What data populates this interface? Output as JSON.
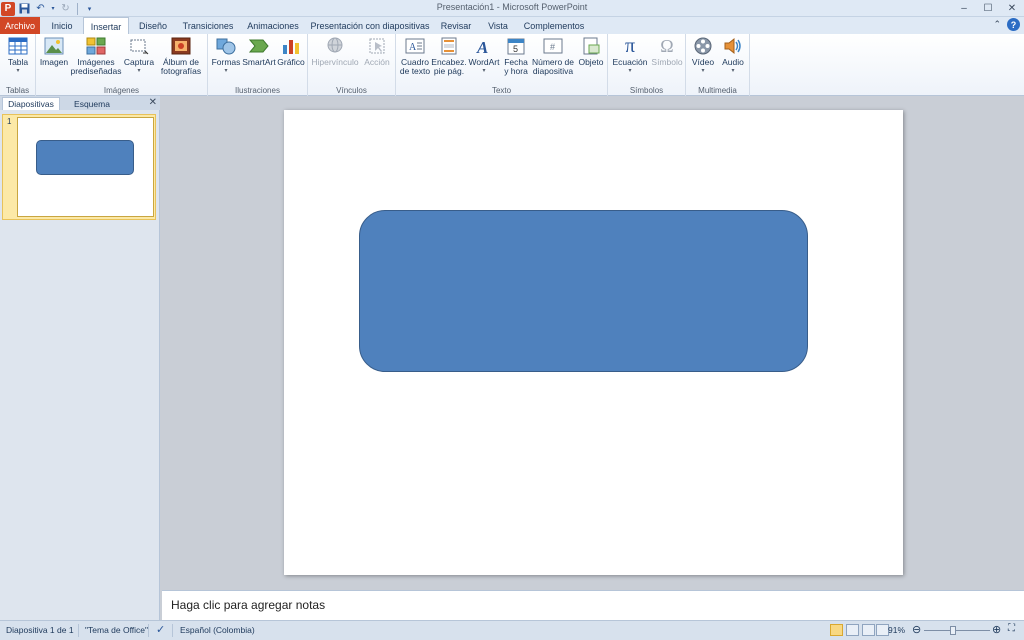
{
  "window": {
    "title": "Presentación1 - Microsoft PowerPoint",
    "app_icon_letter": "P"
  },
  "tabs": [
    {
      "label": "Archivo"
    },
    {
      "label": "Inicio"
    },
    {
      "label": "Insertar",
      "active": true
    },
    {
      "label": "Diseño"
    },
    {
      "label": "Transiciones"
    },
    {
      "label": "Animaciones"
    },
    {
      "label": "Presentación con diapositivas"
    },
    {
      "label": "Revisar"
    },
    {
      "label": "Vista"
    },
    {
      "label": "Complementos"
    }
  ],
  "ribbon": {
    "groups": {
      "tablas": "Tablas",
      "imagenes": "Imágenes",
      "ilustraciones": "Ilustraciones",
      "vinculos": "Vínculos",
      "texto": "Texto",
      "simbolos": "Símbolos",
      "multimedia": "Multimedia"
    },
    "buttons": {
      "tabla": "Tabla",
      "imagen": "Imagen",
      "imagenes_pred_1": "Imágenes",
      "imagenes_pred_2": "prediseñadas",
      "captura": "Captura",
      "album_1": "Álbum de",
      "album_2": "fotografías",
      "formas": "Formas",
      "smartart": "SmartArt",
      "grafico": "Gráfico",
      "hipervinculo": "Hipervínculo",
      "accion": "Acción",
      "cuadro_1": "Cuadro",
      "cuadro_2": "de texto",
      "encabez_1": "Encabez.",
      "encabez_2": "pie pág.",
      "wordart": "WordArt",
      "fecha_1": "Fecha",
      "fecha_2": "y hora",
      "numero_1": "Número de",
      "numero_2": "diapositiva",
      "objeto": "Objeto",
      "ecuacion": "Ecuación",
      "simbolo": "Símbolo",
      "video": "Vídeo",
      "audio": "Audio"
    }
  },
  "left_pane": {
    "tab_slides": "Diapositivas",
    "tab_outline": "Esquema",
    "slide_number": "1"
  },
  "notes": {
    "placeholder": "Haga clic para agregar notas"
  },
  "status": {
    "slide_info": "Diapositiva 1 de 1",
    "theme": "\"Tema de Office\"",
    "language": "Español (Colombia)",
    "zoom": "91%"
  },
  "colors": {
    "shape_fill": "#4f81bd",
    "shape_border": "#385d8a",
    "file_tab": "#d24726"
  }
}
